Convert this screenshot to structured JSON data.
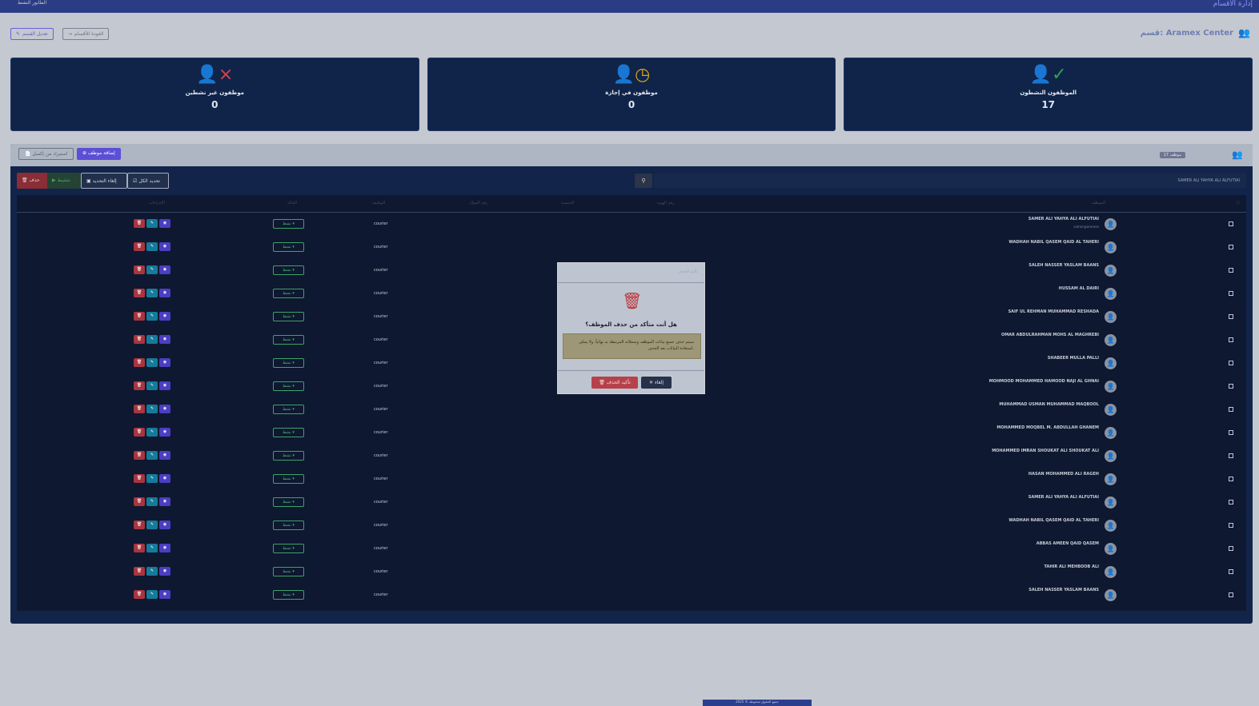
{
  "topbar": {
    "app_title": "إدارة الأقسام",
    "left_text": "الطابور النشط"
  },
  "section": {
    "title": "قسم: Aramex Center"
  },
  "buttons": {
    "back": "العودة للأقسام",
    "edit": "تعديل القسم"
  },
  "cards": [
    {
      "label": "الموظفون النشطون",
      "value": "17"
    },
    {
      "label": "موظفون في إجازة",
      "value": "0"
    },
    {
      "label": "موظفون غير نشطين",
      "value": "0"
    }
  ],
  "panel": {
    "badge": "17 موظف",
    "add_button": "إضافة موظف",
    "import_button": "استيراد من إكسل"
  },
  "toolbar": {
    "select_all": "تحديد الكل",
    "cancel_selection": "إلغاء التحديد",
    "activate": "تنشيط",
    "delete": "حذف",
    "search_value": "SAMER ALI YAHYA ALI ALFUTIAI"
  },
  "table": {
    "headers": [
      "الموظف",
      "رقم الهوية",
      "الجنسية",
      "رقم الجوال",
      "الوظيفة",
      "الحالة",
      "الإجراءات"
    ],
    "rows": [
      {
        "name": "SAMER ALI YAHYA ALI ALFUTIAI",
        "sub": "samer@aramex",
        "role": "courier",
        "status": "نشط"
      },
      {
        "name": "WADHAH NABIL QASEM QAID AL TAHERI",
        "sub": "",
        "role": "courier",
        "status": "نشط"
      },
      {
        "name": "SALEH NASSER YASLAM BAANS",
        "sub": "",
        "role": "courier",
        "status": "نشط"
      },
      {
        "name": "HUSSAM AL DAIRI",
        "sub": "",
        "role": "courier",
        "status": "نشط"
      },
      {
        "name": "SAIF UL REHMAN MUHAMMAD RESHADA",
        "sub": "",
        "role": "courier",
        "status": "نشط"
      },
      {
        "name": "OMAR ABDULRAHMAN MOHS AL MAGHREBI",
        "sub": "",
        "role": "courier",
        "status": "نشط"
      },
      {
        "name": "SHABEER MULLA PALLI",
        "sub": "",
        "role": "courier",
        "status": "نشط"
      },
      {
        "name": "MOHMOOD MOHAMMED HAMOOD NAJI AL GHNAI",
        "sub": "",
        "role": "courier",
        "status": "نشط"
      },
      {
        "name": "MUHAMMAD USMAN MUHAMMAD MAQBOOL",
        "sub": "",
        "role": "courier",
        "status": "نشط"
      },
      {
        "name": "MOHAMMED MOQBEL M. ABDULLAH GHANEM",
        "sub": "",
        "role": "courier",
        "status": "نشط"
      },
      {
        "name": "MOHAMMED IMRAN SHOUKAT ALI SHOUKAT ALI",
        "sub": "",
        "role": "courier",
        "status": "نشط"
      },
      {
        "name": "HASAN MOHAMMED ALI RAGEH",
        "sub": "",
        "role": "courier",
        "status": "نشط"
      },
      {
        "name": "SAMER ALI YAHYA ALI ALFUTIAI",
        "sub": "",
        "role": "courier",
        "status": "نشط"
      },
      {
        "name": "WADHAH NABIL QASEM QAID AL TAHERI",
        "sub": "",
        "role": "courier",
        "status": "نشط"
      },
      {
        "name": "ABBAS AMEEN QAID QASEM",
        "sub": "",
        "role": "courier",
        "status": "نشط"
      },
      {
        "name": "TAHIR ALI MEHBOOB ALI",
        "sub": "",
        "role": "courier",
        "status": "نشط"
      },
      {
        "name": "SALEH NASSER YASLAM BAANS",
        "sub": "",
        "role": "courier",
        "status": "نشط"
      }
    ]
  },
  "modal": {
    "header": "تأكيد الحذف",
    "question": "هل أنت متأكد من حذف الموظف؟",
    "warning": "سيتم حذف جميع بيانات الموظف وسجلاته المرتبطة به نهائياً. ولا يمكن استعادة البيانات بعد الحذف.",
    "cancel": "إلغاء",
    "confirm": "تأكيد الحذف"
  },
  "footer": {
    "text": "جميع الحقوق محفوظة © 2025"
  }
}
